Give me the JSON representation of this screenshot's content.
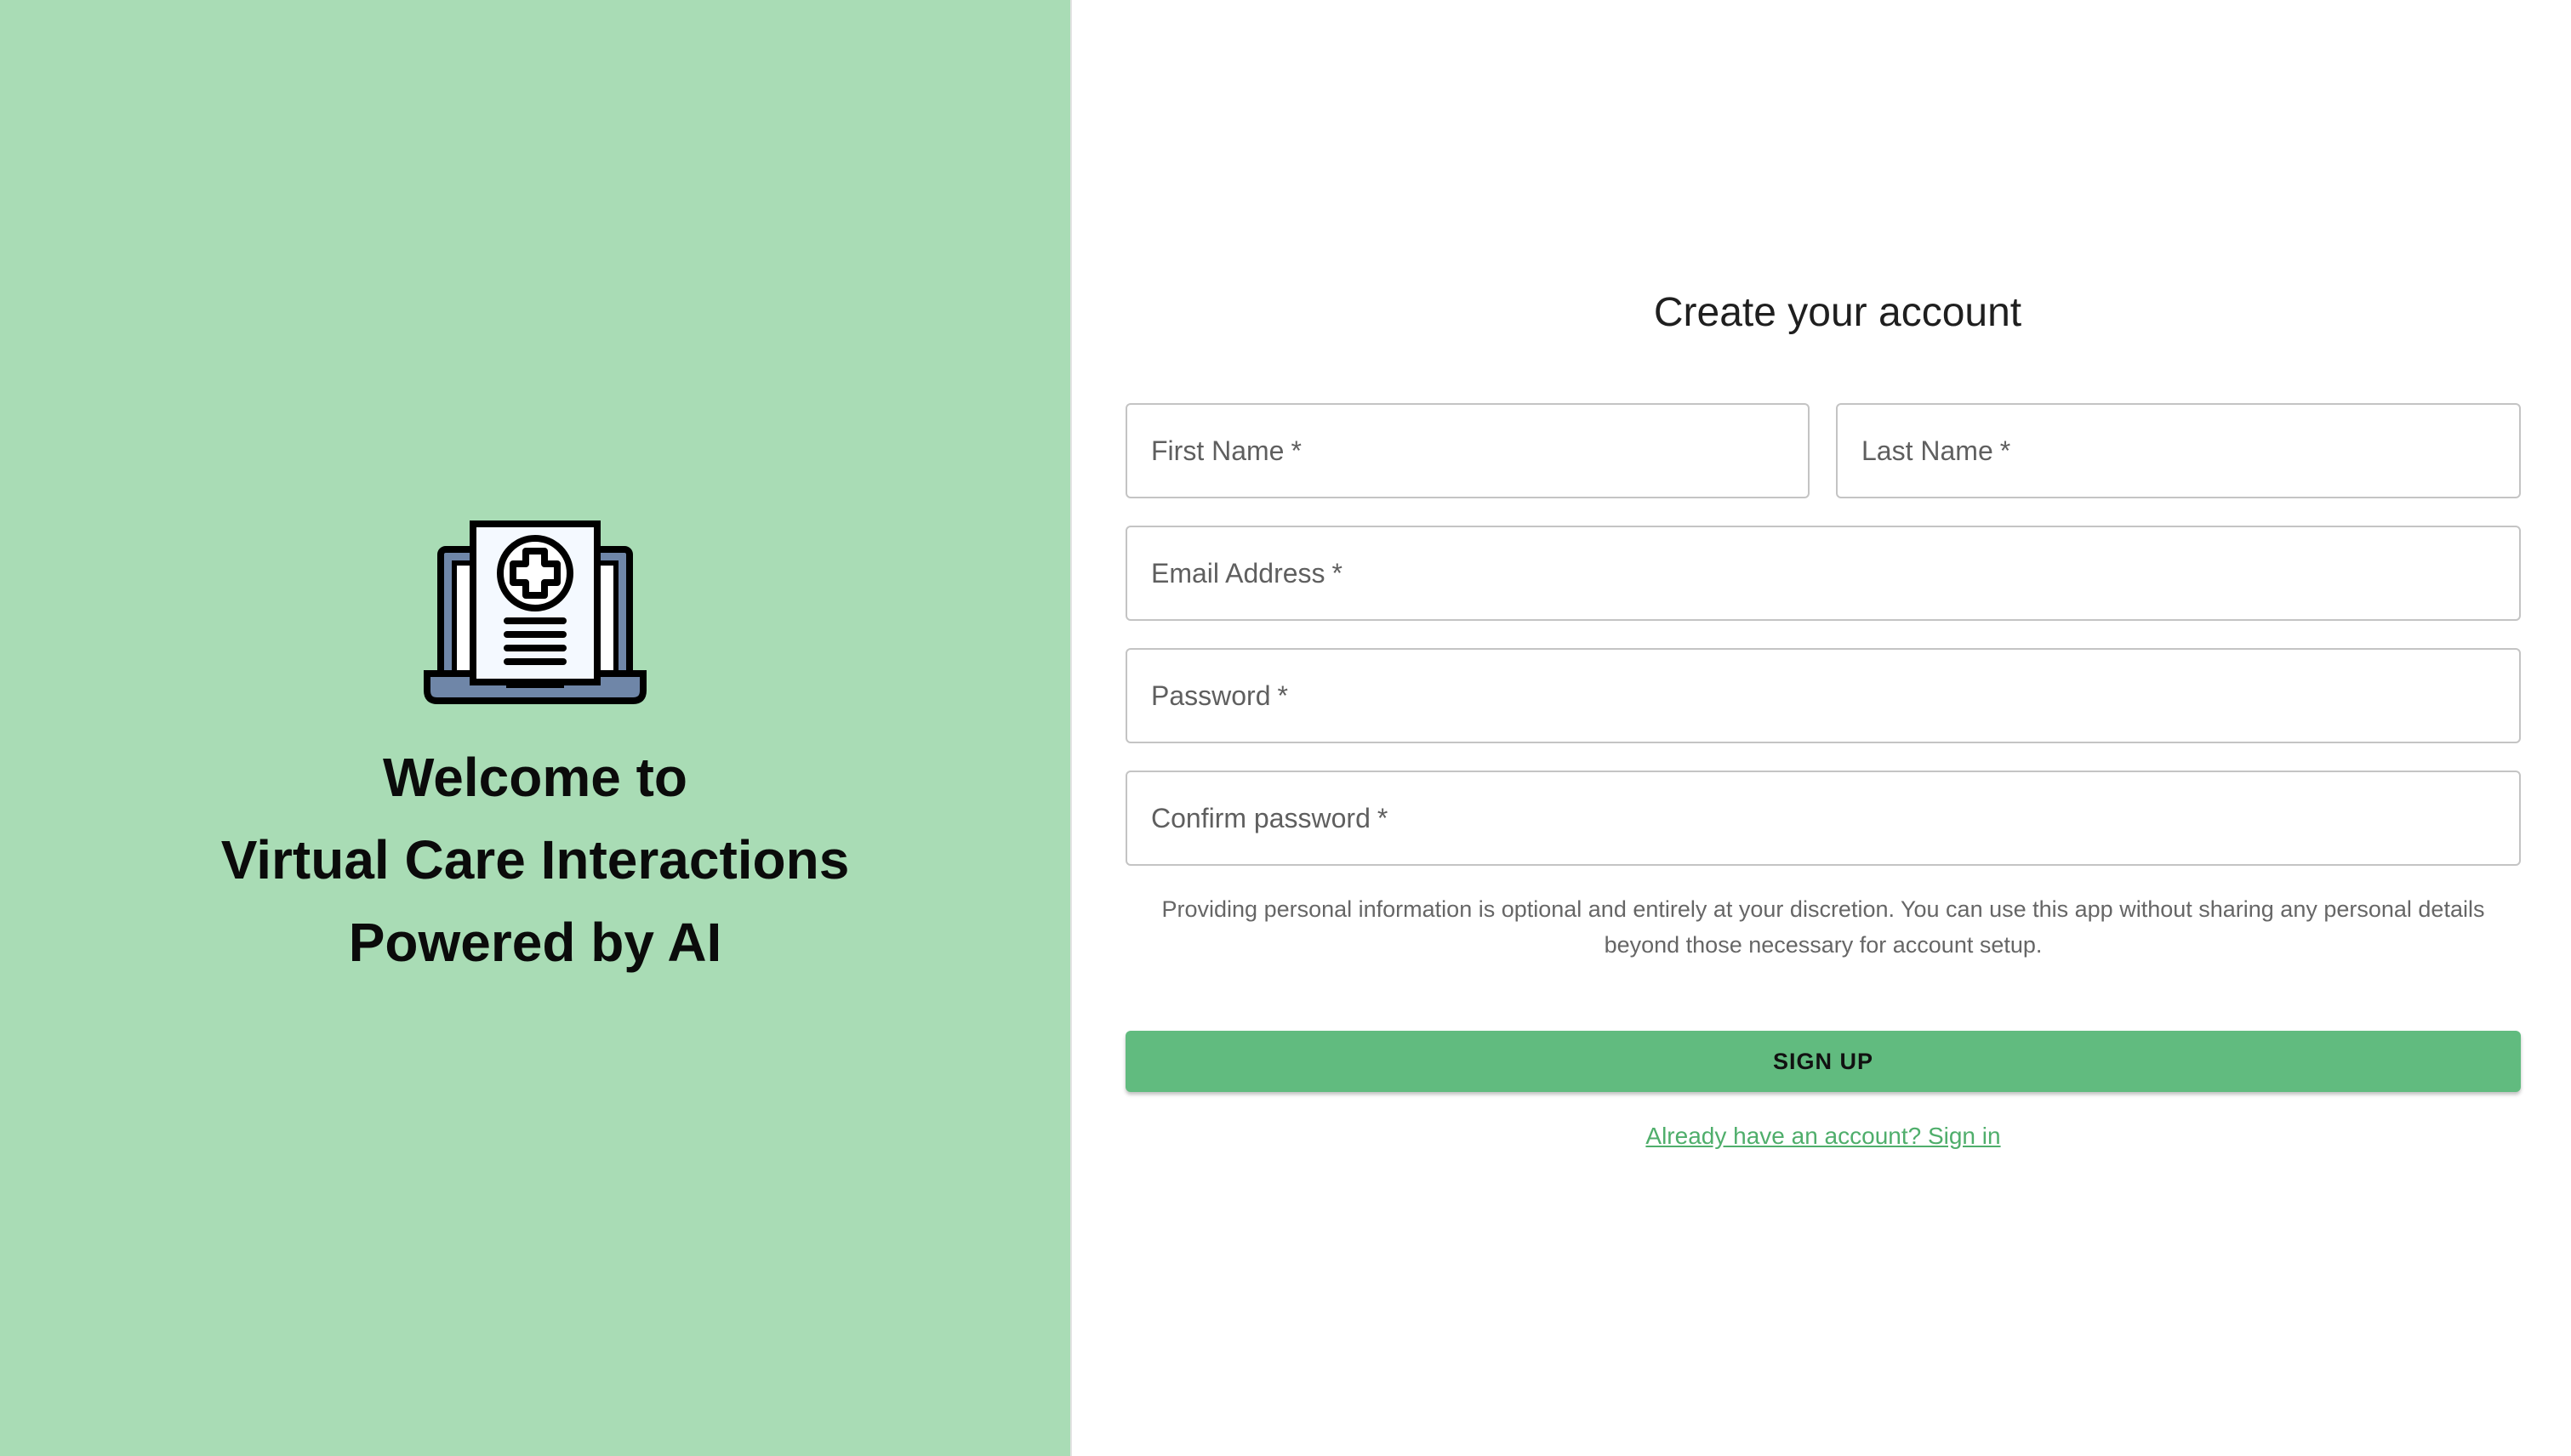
{
  "welcome": {
    "line1": "Welcome to",
    "line2": "Virtual Care Interactions",
    "line3": "Powered by AI"
  },
  "logo_icon": "laptop-medical-document-icon",
  "form": {
    "title": "Create your account",
    "first_name_placeholder": "First Name",
    "last_name_placeholder": "Last Name",
    "email_placeholder": "Email Address",
    "password_placeholder": "Password",
    "confirm_password_placeholder": "Confirm password",
    "required_marker": "*",
    "disclaimer": "Providing personal information is optional and entirely at your discretion. You can use this app without sharing any personal details beyond those necessary for account setup.",
    "signup_label": "SIGN UP",
    "signin_link": "Already have an account? Sign in"
  },
  "colors": {
    "left_panel_bg": "#a9dcb5",
    "button_bg": "#61bb7f",
    "link": "#4fae6b"
  }
}
